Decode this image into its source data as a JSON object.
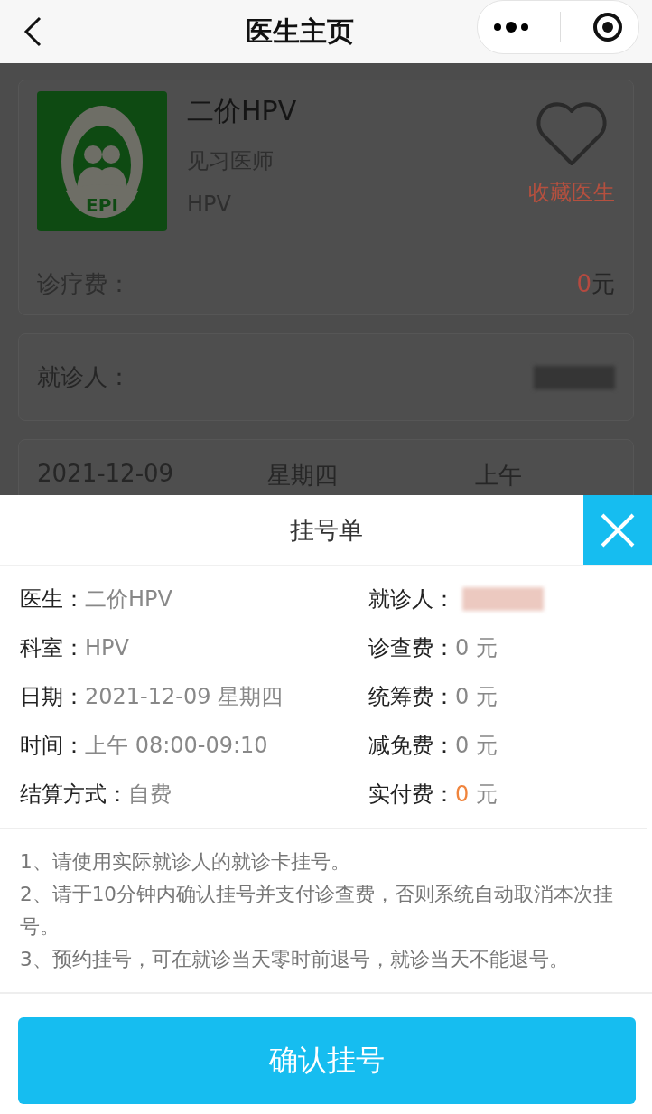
{
  "nav": {
    "title": "医生主页"
  },
  "doctor": {
    "name": "二价HPV",
    "title": "见习医师",
    "department": "HPV",
    "logo_text": "EPI",
    "favorite_label": "收藏医生",
    "favorited": false,
    "fee_label": "诊疗费：",
    "fee_amount": "0",
    "fee_unit": "元"
  },
  "patient": {
    "label": "就诊人："
  },
  "schedule": {
    "date": "2021-12-09",
    "weekday": "星期四",
    "period": "上午"
  },
  "sheet": {
    "title": "挂号单",
    "left_items": [
      {
        "label": "医生：",
        "value": "二价HPV"
      },
      {
        "label": "科室：",
        "value": "HPV"
      },
      {
        "label": "日期：",
        "value": "2021-12-09 星期四"
      },
      {
        "label": "时间：",
        "value": "上午 08:00-09:10"
      },
      {
        "label": "结算方式：",
        "value": "自费"
      }
    ],
    "right_items": [
      {
        "kind": "redacted",
        "label": "就诊人："
      },
      {
        "kind": "fee",
        "label": "诊查费：",
        "amount": "0",
        "unit": "元",
        "highlight": false
      },
      {
        "kind": "fee",
        "label": "统筹费：",
        "amount": "0",
        "unit": "元",
        "highlight": false
      },
      {
        "kind": "fee",
        "label": "减免费：",
        "amount": "0",
        "unit": "元",
        "highlight": false
      },
      {
        "kind": "fee",
        "label": "实付费：",
        "amount": "0",
        "unit": "元",
        "highlight": true
      }
    ],
    "notes": [
      "1、请使用实际就诊人的就诊卡挂号。",
      "2、请于10分钟内确认挂号并支付诊查费，否则系统自动取消本次挂号。",
      "3、预约挂号，可在就诊当天零时前退号，就诊当天不能退号。"
    ],
    "confirm_button": "确认挂号"
  }
}
